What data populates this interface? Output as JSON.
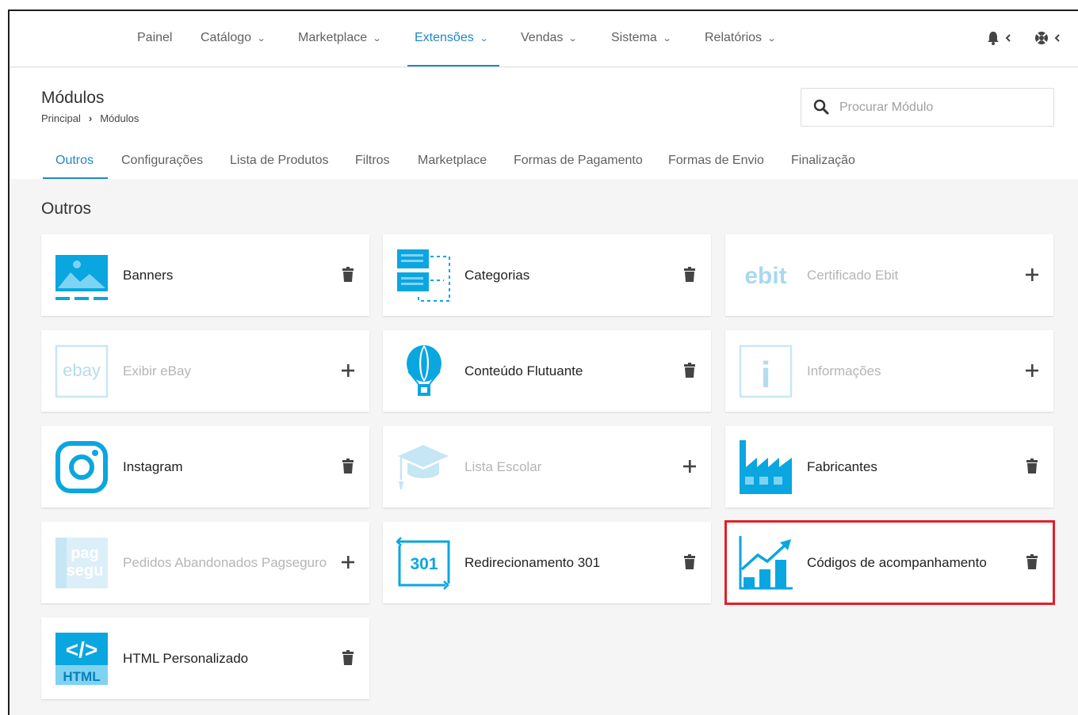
{
  "nav": {
    "items": [
      {
        "label": "Painel",
        "dropdown": false
      },
      {
        "label": "Catálogo",
        "dropdown": true
      },
      {
        "label": "Marketplace",
        "dropdown": true
      },
      {
        "label": "Extensões",
        "dropdown": true,
        "active": true
      },
      {
        "label": "Vendas",
        "dropdown": true
      },
      {
        "label": "Sistema",
        "dropdown": true
      },
      {
        "label": "Relatórios",
        "dropdown": true
      }
    ],
    "right_icons": [
      "bell-icon",
      "help-icon"
    ]
  },
  "header": {
    "title": "Módulos",
    "breadcrumb": [
      "Principal",
      "Módulos"
    ],
    "search_placeholder": "Procurar Módulo"
  },
  "tabs": [
    {
      "label": "Outros",
      "active": true
    },
    {
      "label": "Configurações"
    },
    {
      "label": "Lista de Produtos"
    },
    {
      "label": "Filtros"
    },
    {
      "label": "Marketplace"
    },
    {
      "label": "Formas de Pagamento"
    },
    {
      "label": "Formas de Envio"
    },
    {
      "label": "Finalização"
    }
  ],
  "section": {
    "title": "Outros"
  },
  "modules": [
    {
      "label": "Banners",
      "icon": "banner-image-icon",
      "installed": true,
      "action": "delete"
    },
    {
      "label": "Categorias",
      "icon": "categories-icon",
      "installed": true,
      "action": "delete"
    },
    {
      "label": "Certificado Ebit",
      "icon": "ebit-logo-icon",
      "installed": false,
      "action": "add"
    },
    {
      "label": "Exibir eBay",
      "icon": "ebay-logo-icon",
      "installed": false,
      "action": "add"
    },
    {
      "label": "Conteúdo Flutuante",
      "icon": "hot-air-balloon-icon",
      "installed": true,
      "action": "delete"
    },
    {
      "label": "Informações",
      "icon": "info-icon",
      "installed": false,
      "action": "add"
    },
    {
      "label": "Instagram",
      "icon": "instagram-icon",
      "installed": true,
      "action": "delete"
    },
    {
      "label": "Lista Escolar",
      "icon": "graduation-cap-icon",
      "installed": false,
      "action": "add"
    },
    {
      "label": "Fabricantes",
      "icon": "factory-icon",
      "installed": true,
      "action": "delete"
    },
    {
      "label": "Pedidos Abandonados Pagseguro",
      "icon": "pagseguro-logo-icon",
      "installed": false,
      "action": "add"
    },
    {
      "label": "Redirecionamento 301",
      "icon": "redirect-301-icon",
      "installed": true,
      "action": "delete"
    },
    {
      "label": "Códigos de acompanhamento",
      "icon": "growth-chart-icon",
      "installed": true,
      "action": "delete",
      "highlighted": true
    },
    {
      "label": "HTML Personalizado",
      "icon": "html-code-icon",
      "installed": true,
      "action": "delete"
    }
  ],
  "icon_texts": {
    "ebit": "ebit",
    "ebay": "ebay",
    "info": "i",
    "pag1": "pag",
    "pag2": "segu",
    "r301": "301",
    "code": "</>",
    "html": "HTML"
  },
  "colors": {
    "accent": "#1e88c9",
    "icon_blue": "#0aa6e0",
    "highlight": "#e02027"
  }
}
